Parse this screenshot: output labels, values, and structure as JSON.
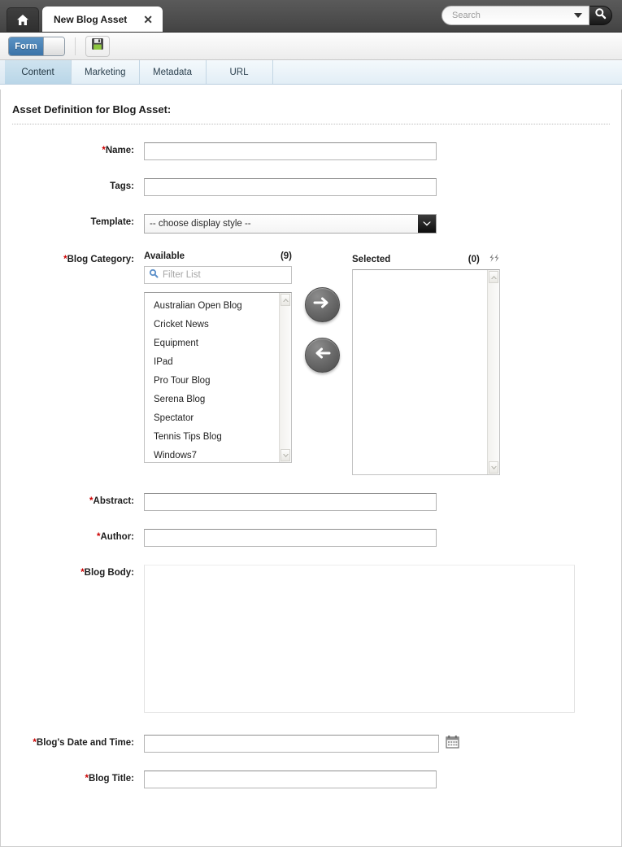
{
  "window": {
    "home_tab_icon": "home-icon",
    "tab_title": "New Blog Asset",
    "tab_close": "✕"
  },
  "search": {
    "placeholder": "Search",
    "dropdown_icon": "chevron-down-icon",
    "button_icon": "search-icon"
  },
  "toolbar": {
    "toggle_label": "Form",
    "save_icon": "floppy-disk-save-icon"
  },
  "subtabs": [
    {
      "label": "Content",
      "active": true
    },
    {
      "label": "Marketing",
      "active": false
    },
    {
      "label": "Metadata",
      "active": false
    },
    {
      "label": "URL",
      "active": false
    }
  ],
  "main": {
    "heading": "Asset Definition for Blog Asset:"
  },
  "fields": {
    "name": {
      "label": "Name:",
      "required": true,
      "value": ""
    },
    "tags": {
      "label": "Tags:",
      "required": false,
      "value": ""
    },
    "template": {
      "label": "Template:",
      "required": false,
      "selected": "-- choose display style --",
      "options": [
        "-- choose display style --"
      ]
    },
    "blog_category": {
      "label": "Blog Category:",
      "required": true
    },
    "abstract": {
      "label": "Abstract:",
      "required": true,
      "value": ""
    },
    "author": {
      "label": "Author:",
      "required": true,
      "value": ""
    },
    "blog_body": {
      "label": "Blog Body:",
      "required": true,
      "value": ""
    },
    "blog_date": {
      "label": "Blog's Date and Time:",
      "required": true,
      "value": "",
      "picker_icon": "calendar-icon"
    },
    "blog_title": {
      "label": "Blog Title:",
      "required": true,
      "value": ""
    }
  },
  "dual_list": {
    "available": {
      "title": "Available",
      "count": "(9)",
      "filter_placeholder": "Filter List",
      "filter_icon": "search-icon",
      "items": [
        "Australian Open Blog",
        "Cricket News",
        "Equipment",
        "IPad",
        "Pro Tour Blog",
        "Serena Blog",
        "Spectator",
        "Tennis Tips Blog",
        "Windows7"
      ]
    },
    "selected": {
      "title": "Selected",
      "count": "(0)",
      "items": []
    },
    "add_icon": "arrow-right-icon",
    "remove_icon": "arrow-left-icon",
    "swap_icon": "refresh-swap-icon"
  },
  "colors": {
    "accent_blue": "#3b73a8",
    "required_red": "#cc0000",
    "tab_active": "#cfe3ef",
    "topbar": "#4e4e4e"
  }
}
